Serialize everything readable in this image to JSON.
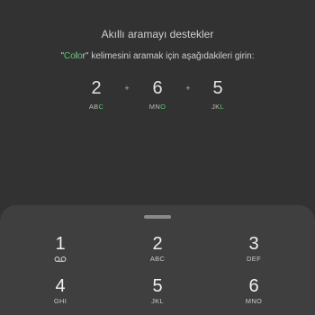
{
  "tip": {
    "title": "Akıllı aramayı destekler",
    "instruction_prefix": "\"",
    "instruction_highlight_1": "Co",
    "instruction_mid": "l",
    "instruction_highlight_2": "o",
    "instruction_after_word": "r",
    "instruction_suffix": "\" kelimesini aramak için aşağıdakileri girin:"
  },
  "example": {
    "plus": "+",
    "keys": [
      {
        "digit": "2",
        "letters_pre": "AB",
        "letters_on": "C",
        "letters_post": ""
      },
      {
        "digit": "6",
        "letters_pre": "MN",
        "letters_on": "O",
        "letters_post": ""
      },
      {
        "digit": "5",
        "letters_pre": "JK",
        "letters_on": "L",
        "letters_post": ""
      }
    ],
    "highlight_color": "#4fd16a"
  },
  "keypad": {
    "keys": [
      {
        "digit": "1",
        "sub": "",
        "icon": "voicemail-icon"
      },
      {
        "digit": "2",
        "sub": "ABC"
      },
      {
        "digit": "3",
        "sub": "DEF"
      },
      {
        "digit": "4",
        "sub": "GHI"
      },
      {
        "digit": "5",
        "sub": "JKL"
      },
      {
        "digit": "6",
        "sub": "MNO"
      }
    ]
  }
}
